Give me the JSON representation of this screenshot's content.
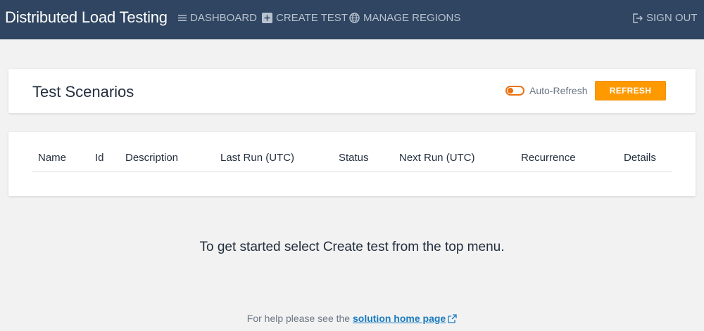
{
  "navbar": {
    "brand": "Distributed Load Testing",
    "dashboard": "DASHBOARD",
    "create_test": "CREATE TEST",
    "manage_regions": "MANAGE REGIONS",
    "sign_out": "SIGN OUT",
    "icons": {
      "dashboard": "menu-lines-icon",
      "create_test": "plus-square-icon",
      "manage_regions": "globe-icon",
      "sign_out": "sign-out-icon"
    }
  },
  "header": {
    "title": "Test Scenarios",
    "auto_refresh_label": "Auto-Refresh",
    "auto_refresh_on": false,
    "refresh_button": "REFRESH"
  },
  "table": {
    "columns": [
      "Name",
      "Id",
      "Description",
      "Last Run (UTC)",
      "Status",
      "Next Run (UTC)",
      "Recurrence",
      "Details"
    ],
    "rows": []
  },
  "empty_message": "To get started select Create test from the top menu.",
  "help": {
    "prefix": "For help please see the",
    "link_text": "solution home page"
  },
  "colors": {
    "navbar_bg": "#2f4561",
    "accent": "#ff9900",
    "link": "#1b7bbf"
  }
}
